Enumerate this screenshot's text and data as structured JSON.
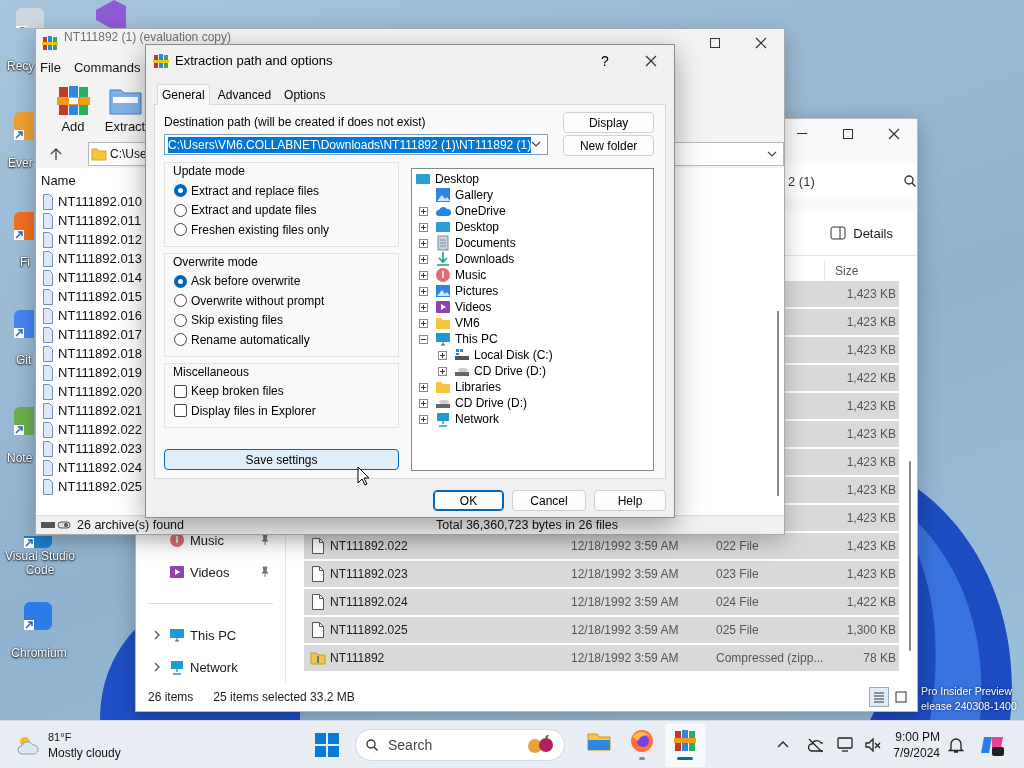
{
  "desktop_icons": [
    {
      "label": "Recy"
    },
    {
      "label": "Ever"
    },
    {
      "label": "Fi"
    },
    {
      "label": "Git"
    },
    {
      "label": "Note"
    },
    {
      "label": "Visual Studio Code"
    },
    {
      "label": "Chromium"
    }
  ],
  "watermark": [
    "Pro Insider Preview",
    "elease 240308-1400"
  ],
  "explorer": {
    "address_fragment": "2 (1)",
    "details_button": "Details",
    "size_column": "Size",
    "sidebar": [
      {
        "label": "Music",
        "kind": "pinned"
      },
      {
        "label": "Videos",
        "kind": "pinned"
      },
      {
        "label": "This PC",
        "kind": "location"
      },
      {
        "label": "Network",
        "kind": "location"
      }
    ],
    "rows": [
      {
        "size": "1,423 KB",
        "selected": true
      },
      {
        "size": "1,423 KB",
        "selected": true
      },
      {
        "size": "1,423 KB",
        "selected": true
      },
      {
        "size": "1,422 KB",
        "selected": true
      },
      {
        "size": "1,423 KB",
        "selected": true
      },
      {
        "size": "1,423 KB",
        "selected": true
      },
      {
        "size": "1,423 KB",
        "selected": true
      },
      {
        "size": "1,423 KB",
        "selected": true
      },
      {
        "size": "1,423 KB",
        "selected": true
      },
      {
        "kind": "file",
        "name": "NT111892.022",
        "date": "12/18/1992 3:59 AM",
        "type": "022 File",
        "size": "1,423 KB",
        "selected": true
      },
      {
        "kind": "file",
        "name": "NT111892.023",
        "date": "12/18/1992 3:59 AM",
        "type": "023 File",
        "size": "1,423 KB",
        "selected": true
      },
      {
        "kind": "file",
        "name": "NT111892.024",
        "date": "12/18/1992 3:59 AM",
        "type": "024 File",
        "size": "1,422 KB",
        "selected": true
      },
      {
        "kind": "file",
        "name": "NT111892.025",
        "date": "12/18/1992 3:59 AM",
        "type": "025 File",
        "size": "1,300 KB",
        "selected": true
      },
      {
        "kind": "zip",
        "name": "NT111892",
        "date": "12/18/1992 3:59 AM",
        "type": "Compressed (zipp...",
        "size": "78 KB",
        "selected": true
      }
    ],
    "status_count": "26 items",
    "status_selection": "25 items selected 33.2 MB",
    "view_buttons": [
      {
        "kind": "details",
        "selected": true
      },
      {
        "kind": "tiles",
        "selected": false
      }
    ]
  },
  "winrar": {
    "title": "NT111892 (1) (evaluation copy)",
    "menu": [
      "File",
      "Commands"
    ],
    "toolbar": [
      {
        "label": "Add",
        "kind": "add"
      },
      {
        "label": "Extract",
        "kind": "extract"
      }
    ],
    "address": "C:\\Use",
    "name_column": "Name",
    "files": [
      "NT111892.010",
      "NT111892.011",
      "NT111892.012",
      "NT111892.013",
      "NT111892.014",
      "NT111892.015",
      "NT111892.016",
      "NT111892.017",
      "NT111892.018",
      "NT111892.019",
      "NT111892.020",
      "NT111892.021",
      "NT111892.022",
      "NT111892.023",
      "NT111892.024",
      "NT111892.025"
    ],
    "status_left": "26 archive(s) found",
    "status_right": "Total 36,360,723 bytes in 26 files"
  },
  "dialog": {
    "title": "Extraction path and options",
    "help": "?",
    "tabs": [
      {
        "label": "General",
        "selected": true
      },
      {
        "label": "Advanced",
        "selected": false
      },
      {
        "label": "Options",
        "selected": false
      }
    ],
    "destination_label": "Destination path (will be created if does not exist)",
    "destination": {
      "value": "C:\\Users\\VM6.COLLABNET\\Downloads\\NT111892 (1)\\NT111892 (1)",
      "highlighted": true
    },
    "side_buttons": [
      "Display",
      "New folder"
    ],
    "groups": [
      {
        "title": "Update mode",
        "options": [
          {
            "kind": "radio",
            "label": "Extract and replace files",
            "checked": true
          },
          {
            "kind": "radio",
            "label": "Extract and update files",
            "checked": false
          },
          {
            "kind": "radio",
            "label": "Freshen existing files only",
            "checked": false
          }
        ]
      },
      {
        "title": "Overwrite mode",
        "options": [
          {
            "kind": "radio",
            "label": "Ask before overwrite",
            "checked": true
          },
          {
            "kind": "radio",
            "label": "Overwrite without prompt",
            "checked": false
          },
          {
            "kind": "radio",
            "label": "Skip existing files",
            "checked": false
          },
          {
            "kind": "radio",
            "label": "Rename automatically",
            "checked": false
          }
        ]
      },
      {
        "title": "Miscellaneous",
        "options": [
          {
            "kind": "checkbox",
            "label": "Keep broken files",
            "checked": false
          },
          {
            "kind": "checkbox",
            "label": "Display files in Explorer",
            "checked": false
          }
        ]
      }
    ],
    "save_button": {
      "label": "Save settings",
      "hovered": true
    },
    "tree": [
      {
        "label": "Desktop",
        "kind": "desktop",
        "children": [
          {
            "label": "Gallery",
            "kind": "gallery"
          },
          {
            "label": "OneDrive",
            "kind": "cloud",
            "expanded": false
          },
          {
            "label": "Desktop",
            "kind": "desktop",
            "expanded": false
          },
          {
            "label": "Documents",
            "kind": "documents",
            "expanded": false
          },
          {
            "label": "Downloads",
            "kind": "downloads",
            "expanded": false
          },
          {
            "label": "Music",
            "kind": "music",
            "expanded": false
          },
          {
            "label": "Pictures",
            "kind": "pictures",
            "expanded": false
          },
          {
            "label": "Videos",
            "kind": "videos",
            "expanded": false
          },
          {
            "label": "VM6",
            "kind": "folder",
            "expanded": false
          },
          {
            "label": "This PC",
            "kind": "pc",
            "expanded": true,
            "children": [
              {
                "label": "Local Disk (C:)",
                "kind": "disk",
                "expanded": false
              },
              {
                "label": "CD Drive (D:)",
                "kind": "cd",
                "expanded": false
              }
            ]
          },
          {
            "label": "Libraries",
            "kind": "folder",
            "expanded": false
          },
          {
            "label": "CD Drive (D:)",
            "kind": "cd",
            "expanded": false
          },
          {
            "label": "Network",
            "kind": "network",
            "expanded": false
          }
        ]
      }
    ],
    "footer_buttons": [
      {
        "label": "OK",
        "default": true
      },
      {
        "label": "Cancel",
        "default": false
      },
      {
        "label": "Help",
        "default": false
      }
    ]
  },
  "taskbar": {
    "temperature": "81°F",
    "condition": "Mostly cloudy",
    "search_placeholder": "Search",
    "apps": [
      {
        "kind": "explorer",
        "open": false,
        "active": false
      },
      {
        "kind": "firefox",
        "open": true,
        "active": false
      },
      {
        "kind": "winrar",
        "open": true,
        "active": true
      }
    ],
    "time": "9:00 PM",
    "date": "7/9/2024"
  }
}
